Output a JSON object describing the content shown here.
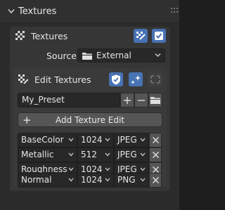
{
  "panel": {
    "title": "Textures"
  },
  "textures_box": {
    "header_label": "Textures",
    "source_label": "Source",
    "source_value": "External"
  },
  "edit_box": {
    "header_label": "Edit Textures",
    "preset_value": "My_Preset",
    "add_button_label": "Add Texture Edit",
    "rows": [
      {
        "name": "BaseColor",
        "size": "1024",
        "format": "JPEG"
      },
      {
        "name": "Metallic",
        "size": "512",
        "format": "JPEG"
      },
      {
        "name": "Roughness",
        "size": "1024",
        "format": "JPEG"
      },
      {
        "name": "Normal",
        "size": "1024",
        "format": "PNG"
      }
    ]
  },
  "colors": {
    "accent": "#4772b3",
    "panel_bg": "#2b2b2b",
    "field_bg": "#282828"
  }
}
